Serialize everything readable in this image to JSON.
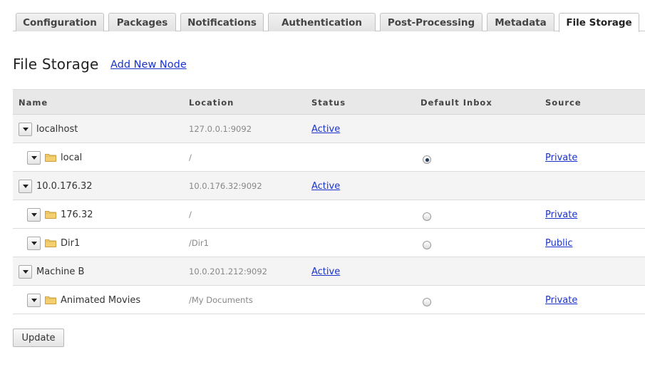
{
  "tabs": [
    {
      "label": "Configuration",
      "active": false
    },
    {
      "label": "Packages",
      "active": false
    },
    {
      "label": "Notifications",
      "active": false
    },
    {
      "label": "Authentication",
      "active": false
    },
    {
      "label": "Post-Processing",
      "active": false
    },
    {
      "label": "Metadata",
      "active": false
    },
    {
      "label": "File Storage",
      "active": true
    }
  ],
  "page": {
    "title": "File Storage",
    "add_node_label": "Add New Node"
  },
  "table": {
    "headers": {
      "name": "Name",
      "location": "Location",
      "status": "Status",
      "default_inbox": "Default Inbox",
      "source": "Source"
    },
    "rows": [
      {
        "type": "host",
        "name": "localhost",
        "location": "127.0.0.1:9092",
        "status": "Active",
        "source": "",
        "default_inbox": null
      },
      {
        "type": "child",
        "name": "local",
        "location": "/",
        "status": "",
        "source": "Private",
        "default_inbox": true
      },
      {
        "type": "host",
        "name": "10.0.176.32",
        "location": "10.0.176.32:9092",
        "status": "Active",
        "source": "",
        "default_inbox": null
      },
      {
        "type": "child",
        "name": "176.32",
        "location": "/",
        "status": "",
        "source": "Private",
        "default_inbox": false
      },
      {
        "type": "child",
        "name": "Dir1",
        "location": "/Dir1",
        "status": "",
        "source": "Public",
        "default_inbox": false
      },
      {
        "type": "host",
        "name": "Machine B",
        "location": "10.0.201.212:9092",
        "status": "Active",
        "source": "",
        "default_inbox": null
      },
      {
        "type": "child",
        "name": "Animated Movies",
        "location": "/My Documents",
        "status": "",
        "source": "Private",
        "default_inbox": false
      }
    ]
  },
  "actions": {
    "update_label": "Update"
  },
  "colors": {
    "link": "#1a33cc",
    "header_bg": "#e8e8e8",
    "host_row_bg": "#f4f4f4",
    "folder": "#f0c860"
  }
}
